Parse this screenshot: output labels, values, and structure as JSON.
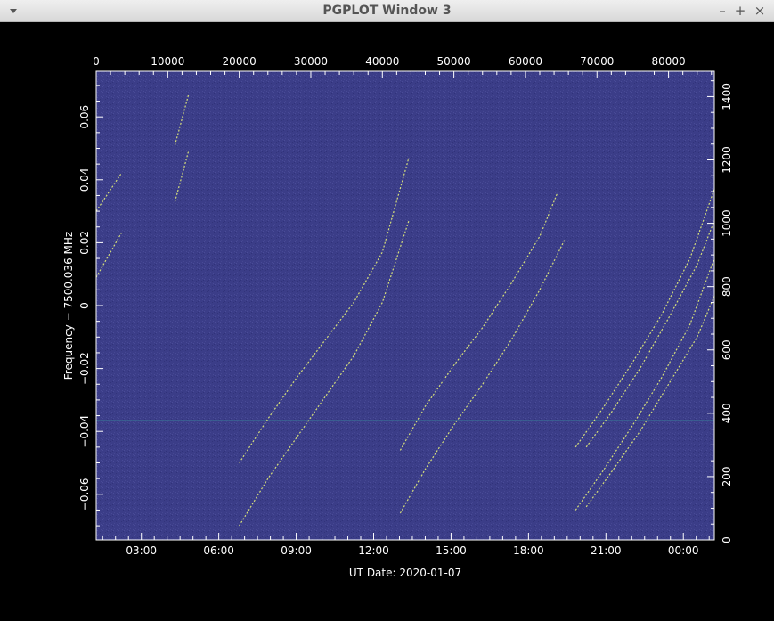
{
  "window": {
    "title": "PGPLOT Window 3",
    "buttons": {
      "minimize": "–",
      "maximize": "+",
      "close": "×"
    }
  },
  "colors": {
    "background": "#000000",
    "plot_bg": "#3b3d88",
    "axes": "#ffffff",
    "trace": "#e6f07a",
    "trace_dim": "#3fa0a8",
    "hline": "#3a7f9a"
  },
  "chart_data": {
    "type": "heatmap",
    "xlabel": "UT Date: 2020-01-07",
    "ylabel": "Frequency − 7500.036 MHz",
    "x_bottom_ticks": [
      "03:00",
      "06:00",
      "09:00",
      "12:00",
      "15:00",
      "18:00",
      "21:00",
      "00:00"
    ],
    "x_top_ticks": [
      "0",
      "10000",
      "20000",
      "30000",
      "40000",
      "50000",
      "60000",
      "70000",
      "80000"
    ],
    "y_left_ticks": [
      "−0.06",
      "−0.04",
      "−0.02",
      "0",
      "0.02",
      "0.04",
      "0.06"
    ],
    "y_right_ticks": [
      "0",
      "200",
      "400",
      "600",
      "800",
      "1000",
      "1200",
      "1400"
    ],
    "top_axis_range": [
      0,
      86400
    ],
    "right_axis_range": [
      0,
      1480
    ],
    "y_range": [
      -0.0745,
      0.0745
    ],
    "hline_y": -0.0365,
    "traces": [
      {
        "x": [
          0,
          3500
        ],
        "y": [
          0.03,
          0.042
        ]
      },
      {
        "x": [
          0,
          3500
        ],
        "y": [
          0.009,
          0.023
        ]
      },
      {
        "x": [
          11000,
          12900
        ],
        "y": [
          0.051,
          0.067
        ]
      },
      {
        "x": [
          11000,
          12900
        ],
        "y": [
          0.033,
          0.049
        ]
      },
      {
        "x": [
          20000,
          24000,
          28000,
          32000,
          36000,
          40000,
          43700
        ],
        "y": [
          -0.05,
          -0.036,
          -0.023,
          -0.011,
          0.001,
          0.017,
          0.047
        ]
      },
      {
        "x": [
          20000,
          24000,
          28000,
          32000,
          36000,
          40000,
          43700
        ],
        "y": [
          -0.07,
          -0.055,
          -0.042,
          -0.029,
          -0.016,
          0.001,
          0.027
        ]
      },
      {
        "x": [
          42500,
          46000,
          50000,
          54000,
          58000,
          62000,
          64500
        ],
        "y": [
          -0.046,
          -0.032,
          -0.019,
          -0.007,
          0.007,
          0.022,
          0.036
        ]
      },
      {
        "x": [
          42500,
          46000,
          50000,
          54000,
          58000,
          62000,
          65500
        ],
        "y": [
          -0.066,
          -0.052,
          -0.038,
          -0.025,
          -0.011,
          0.005,
          0.021
        ]
      },
      {
        "x": [
          67000,
          71000,
          75000,
          79000,
          83000,
          86400
        ],
        "y": [
          -0.045,
          -0.032,
          -0.018,
          -0.003,
          0.015,
          0.037
        ]
      },
      {
        "x": [
          68500,
          72000,
          76000,
          80000,
          84000,
          86400
        ],
        "y": [
          -0.045,
          -0.034,
          -0.02,
          -0.004,
          0.013,
          0.027
        ]
      },
      {
        "x": [
          67000,
          71000,
          75000,
          79000,
          83000,
          86400
        ],
        "y": [
          -0.065,
          -0.052,
          -0.038,
          -0.023,
          -0.006,
          0.015
        ]
      },
      {
        "x": [
          68500,
          72000,
          76000,
          80000,
          84000,
          86400
        ],
        "y": [
          -0.064,
          -0.053,
          -0.04,
          -0.025,
          -0.01,
          0.003
        ]
      }
    ]
  }
}
